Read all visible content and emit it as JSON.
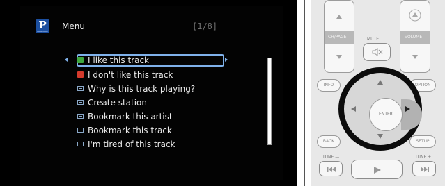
{
  "screen": {
    "logo_letter": "P",
    "logo_word": "PANDORA",
    "title": "Menu",
    "page_indicator": "[1/8]",
    "menu_items": [
      {
        "label": "I like this track",
        "icon": "thumbs-up-icon",
        "selected": true
      },
      {
        "label": "I don't like this track",
        "icon": "thumbs-down-icon",
        "selected": false
      },
      {
        "label": "Why is this track playing?",
        "icon": "menu-item-icon",
        "selected": false
      },
      {
        "label": "Create station",
        "icon": "menu-item-icon",
        "selected": false
      },
      {
        "label": "Bookmark this artist",
        "icon": "menu-item-icon",
        "selected": false
      },
      {
        "label": "Bookmark this track",
        "icon": "menu-item-icon",
        "selected": false
      },
      {
        "label": "I'm tired of this track",
        "icon": "menu-item-icon",
        "selected": false
      }
    ],
    "colors": {
      "accent": "#7fb1ea",
      "thumbs_up": "#3fa83f",
      "thumbs_down": "#d43a2c",
      "logo": "#1c4fa0"
    }
  },
  "remote": {
    "ch_page": "CH/PAGE",
    "mute": "MUTE",
    "volume": "VOLUME",
    "info": "INFO",
    "option": "OPTION",
    "enter": "ENTER",
    "back": "BACK",
    "setup": "SETUP",
    "tune_minus": "TUNE —",
    "tune_plus": "TUNE +",
    "highlighted_button": "right-arrow"
  }
}
